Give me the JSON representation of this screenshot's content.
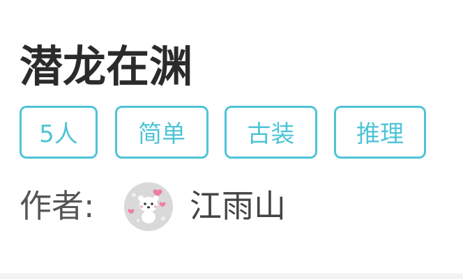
{
  "title": "潜龙在渊",
  "tags": [
    "5人",
    "简单",
    "古装",
    "推理"
  ],
  "author": {
    "label": "作者:",
    "avatar_icon": "cartoon-avatar-icon",
    "name": "江雨山"
  },
  "colors": {
    "accent": "#4ec4d6",
    "title_text": "#2b2b2b",
    "body_text": "#555555"
  }
}
